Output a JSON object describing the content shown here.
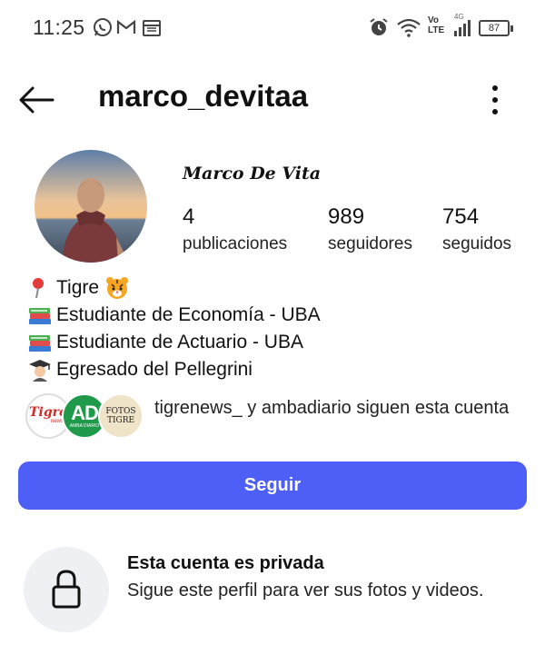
{
  "status_bar": {
    "time": "11:25",
    "network_top": "Vo",
    "network_bottom": "LTE",
    "network_gen": "4G",
    "battery": "87"
  },
  "header": {
    "username": "marco_devitaa"
  },
  "profile": {
    "full_name": "Marco De Vita",
    "stats": [
      {
        "value": "4",
        "label": "publicaciones"
      },
      {
        "value": "989",
        "label": "seguidores"
      },
      {
        "value": "754",
        "label": "seguidos"
      }
    ]
  },
  "bio": [
    {
      "emoji": "pin-icon",
      "text": "Tigre"
    },
    {
      "emoji": "books-icon",
      "text": "Estudiante de Economía - UBA"
    },
    {
      "emoji": "books-icon",
      "text": "Estudiante de Actuario - UBA"
    },
    {
      "emoji": "graduate-icon",
      "text": "Egresado del Pellegrini"
    }
  ],
  "followed_by": {
    "text": "tigrenews_ y ambadiario siguen esta cuenta",
    "avatars": [
      {
        "name": "tigrenews-avatar",
        "label": "Tigre",
        "sub": "news"
      },
      {
        "name": "ambadiario-avatar",
        "label": "AD",
        "sub": "AMBA DIARIO"
      },
      {
        "name": "fotos-tigre-avatar",
        "label": "FOTOS TIGRE"
      }
    ]
  },
  "actions": {
    "follow_label": "Seguir"
  },
  "private": {
    "title": "Esta cuenta es privada",
    "subtitle": "Sigue este perfil para ver sus fotos y videos."
  },
  "colors": {
    "follow_button": "#4e5ff8",
    "lock_circle_bg": "#eef0f3"
  }
}
